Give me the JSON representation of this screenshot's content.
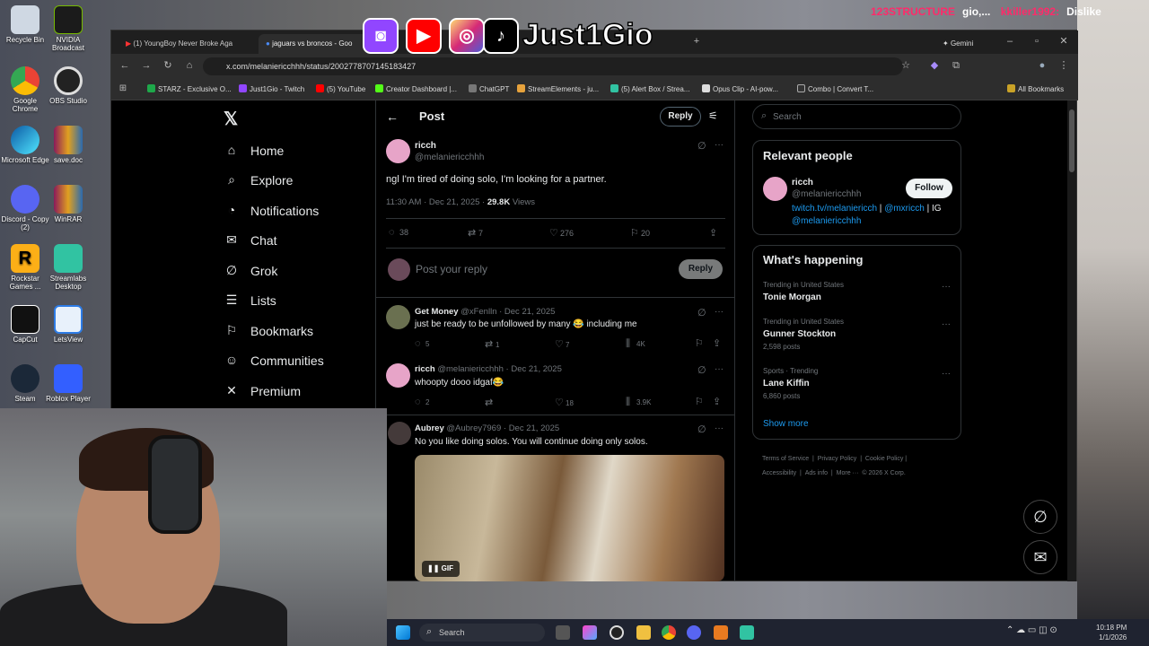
{
  "overlay_top": {
    "user1": "123STRUCTURE",
    "msg1": "gio,...",
    "user2": "kkiller1992:",
    "msg2": "Dislike"
  },
  "desktop_icons": [
    "Recycle Bin",
    "NVIDIA Broadcast",
    "Google Chrome",
    "OBS Studio",
    "Microsoft Edge",
    "save.doc",
    "Discord - Copy (2)",
    "WinRAR",
    "Rockstar Games ...",
    "Streamlabs Desktop",
    "CapCut",
    "LetsView",
    "Steam",
    "Roblox Player"
  ],
  "stream_logo": {
    "name": "Just1Gio"
  },
  "tabs": [
    {
      "label": "(1) YoungBoy Never Broke Aga"
    },
    {
      "label": "jaguars vs broncos - Goo"
    }
  ],
  "gemini_label": "Gemini",
  "url": "x.com/melaniericchhh/status/2002778707145183427",
  "bookmarks": [
    "STARZ - Exclusive O...",
    "Just1Gio - Twitch",
    "(5) YouTube",
    "Creator Dashboard |...",
    "ChatGPT",
    "StreamElements - ju...",
    "(5) Alert Box / Strea...",
    "Opus Clip - AI-pow...",
    "Combo | Convert T..."
  ],
  "all_bookmarks": "All Bookmarks",
  "nav": [
    {
      "label": "Home",
      "icon": "home-icon",
      "glyph": "⌂"
    },
    {
      "label": "Explore",
      "icon": "search-icon",
      "glyph": "⌕"
    },
    {
      "label": "Notifications",
      "icon": "bell-icon",
      "glyph": "◔"
    },
    {
      "label": "Chat",
      "icon": "mail-icon",
      "glyph": "✉"
    },
    {
      "label": "Grok",
      "icon": "grok-icon",
      "glyph": "∅"
    },
    {
      "label": "Lists",
      "icon": "list-icon",
      "glyph": "☰"
    },
    {
      "label": "Bookmarks",
      "icon": "bookmark-icon",
      "glyph": "⚐"
    },
    {
      "label": "Communities",
      "icon": "people-icon",
      "glyph": "☺"
    },
    {
      "label": "Premium",
      "icon": "x-icon",
      "glyph": "✕"
    }
  ],
  "header": {
    "title": "Post",
    "reply_btn": "Reply"
  },
  "post": {
    "name": "ricch",
    "handle": "@melaniericchhh",
    "text": "ngl I'm tired of doing solo, I'm looking for a partner.",
    "meta": "11:30 AM · Dec 21, 2025 · ",
    "views_count": "29.8K",
    "views_label": " Views",
    "replies": "38",
    "reposts": "7",
    "likes": "276",
    "bookmarks": "20"
  },
  "reply_box": {
    "placeholder": "Post your reply",
    "button": "Reply"
  },
  "replies": [
    {
      "name": "Get Money",
      "handle": "@xFenlln · Dec 21, 2025",
      "text": "just be ready to be unfollowed by many 😂 including me",
      "replies": "5",
      "reposts": "1",
      "likes": "7",
      "views": "4K"
    },
    {
      "name": "ricch",
      "handle": "@melaniericchhh · Dec 21, 2025",
      "text": "whoopty dooo idgaf😂",
      "replies": "2",
      "reposts": "",
      "likes": "18",
      "views": "3.9K"
    },
    {
      "name": "Aubrey",
      "handle": "@Aubrey7969 · Dec 21, 2025",
      "text": "No you like doing solos. You will continue doing only solos.",
      "gif_label": "GIF"
    }
  ],
  "search_placeholder": "Search",
  "relevant": {
    "title": "Relevant people",
    "name": "ricch",
    "handle": "@melaniericchhh",
    "follow": "Follow",
    "bio_link1": "twitch.tv/melaniericch",
    "bio_sep1": " | ",
    "bio_link2": "@mxricch",
    "bio_sep2": " | IG",
    "bio_link3": "@melaniericchhh"
  },
  "happening": {
    "title": "What's happening",
    "items": [
      {
        "ctx": "Trending in United States",
        "name": "Tonie Morgan",
        "count": ""
      },
      {
        "ctx": "Trending in United States",
        "name": "Gunner Stockton",
        "count": "2,598 posts"
      },
      {
        "ctx": "Sports · Trending",
        "name": "Lane Kiffin",
        "count": "6,860 posts"
      }
    ],
    "show_more": "Show more"
  },
  "footer": [
    "Terms of Service",
    "|",
    "Privacy Policy",
    "|",
    "Cookie Policy",
    "|",
    "Accessibility",
    "|",
    "Ads info",
    "|",
    "More ···",
    "© 2026 X Corp."
  ],
  "taskbar": {
    "search": "Search",
    "time": "10:18 PM",
    "date": "1/1/2026"
  }
}
